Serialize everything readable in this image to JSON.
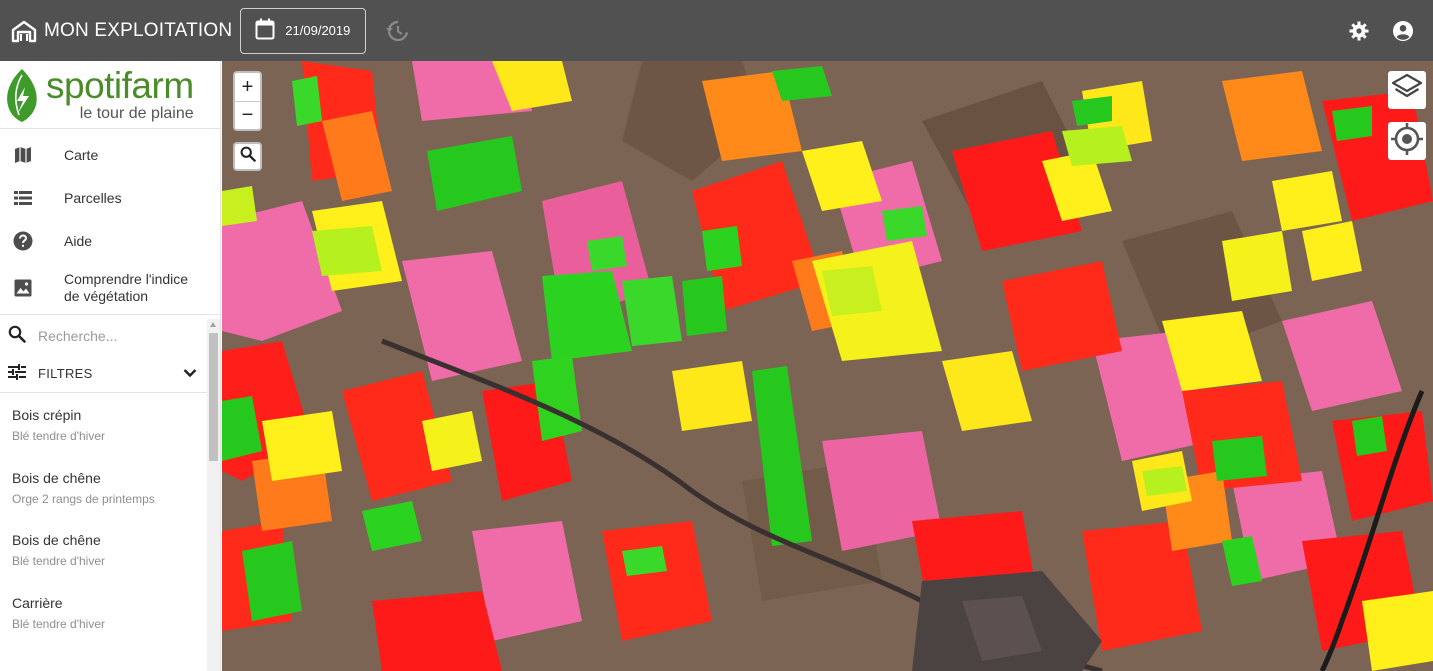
{
  "header": {
    "title": "MON EXPLOITATION",
    "date": "21/09/2019",
    "icons": {
      "brand": "barn-icon",
      "date": "calendar-icon",
      "history": "history-icon",
      "settings": "gear-icon",
      "account": "account-icon"
    }
  },
  "sidebar": {
    "logo": {
      "name": "spotifarm",
      "tagline": "le tour de plaine"
    },
    "nav": [
      {
        "label": "Carte",
        "icon": "map-icon"
      },
      {
        "label": "Parcelles",
        "icon": "list-icon"
      },
      {
        "label": "Aide",
        "icon": "help-icon"
      },
      {
        "label": "Comprendre l'indice de végétation",
        "icon": "image-icon"
      }
    ],
    "search": {
      "placeholder": "Recherche..."
    },
    "filters": {
      "label": "FILTRES"
    },
    "parcels": [
      {
        "name": "Bois crépin",
        "crop": "Blé tendre d'hiver"
      },
      {
        "name": "Bois de chêne",
        "crop": "Orge 2 rangs de printemps"
      },
      {
        "name": "Bois de chêne",
        "crop": "Blé tendre d'hiver"
      },
      {
        "name": "Carrière",
        "crop": "Blé tendre d'hiver"
      }
    ]
  },
  "map": {
    "zoom_in": "+",
    "zoom_out": "−",
    "colors": {
      "soil": "#7a6352",
      "red": "#ff1a1a",
      "pink": "#f06ca8",
      "yellow": "#ffef1a",
      "green": "#27c81e",
      "orange": "#ff8a1a"
    }
  }
}
